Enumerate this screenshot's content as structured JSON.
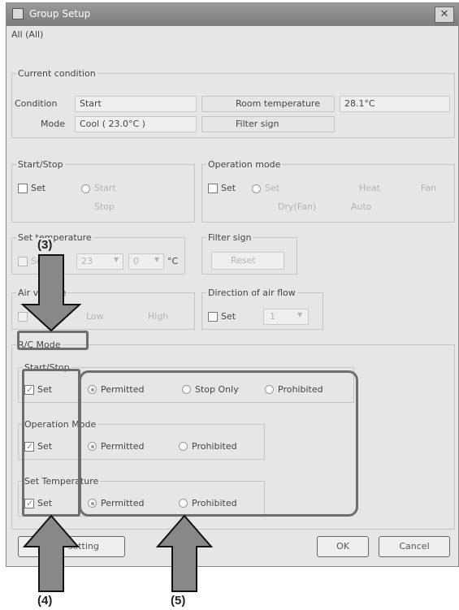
{
  "window": {
    "title": "Group Setup",
    "close_glyph": "✕"
  },
  "scope_label": "All (All)",
  "current_condition": {
    "legend": "Current condition",
    "condition_label": "Condition",
    "condition_value": "Start",
    "mode_label": "Mode",
    "mode_value": "Cool ( 23.0°C )",
    "room_temp_label": "Room temperature",
    "room_temp_value": "28.1°C",
    "filter_sign_label": "Filter sign"
  },
  "start_stop": {
    "legend": "Start/Stop",
    "set_label": "Set",
    "option1": "Start",
    "option2": "Stop"
  },
  "operation_mode": {
    "legend": "Operation mode",
    "set_label": "Set",
    "opt_a": "Set",
    "opt_b": "Heat",
    "opt_c": "Fan",
    "opt_d": "Dry(Fan)",
    "opt_e": "Auto"
  },
  "set_temperature": {
    "legend": "Set temperature",
    "set_label": "Set",
    "value1": "23",
    "value2": "0",
    "unit": "°C"
  },
  "filter_sign": {
    "legend": "Filter sign",
    "reset_label": "Reset"
  },
  "air_volume": {
    "legend": "Air volume",
    "low_label": "Low",
    "high_label": "High"
  },
  "airflow": {
    "legend": "Direction of air flow",
    "set_label": "Set",
    "value": "1"
  },
  "rc_mode": {
    "legend": "R/C Mode",
    "start_stop": {
      "legend": "Start/Stop",
      "set_label": "Set",
      "permitted": "Permitted",
      "stop_only": "Stop Only",
      "prohibited": "Prohibited"
    },
    "operation_mode": {
      "legend": "Operation Mode",
      "set_label": "Set",
      "permitted": "Permitted",
      "prohibited": "Prohibited"
    },
    "set_temperature": {
      "legend": "Set Temperature",
      "set_label": "Set",
      "permitted": "Permitted",
      "prohibited": "Prohibited"
    }
  },
  "footer": {
    "view_setting": "View setting",
    "ok": "OK",
    "cancel": "Cancel"
  },
  "callouts": {
    "c3": "(3)",
    "c4": "(4)",
    "c5": "(5)"
  },
  "colors": {
    "title_bar": "#8a8a8a",
    "dialog_bg": "#e6e6e6",
    "highlight": "#6e6e6e"
  }
}
